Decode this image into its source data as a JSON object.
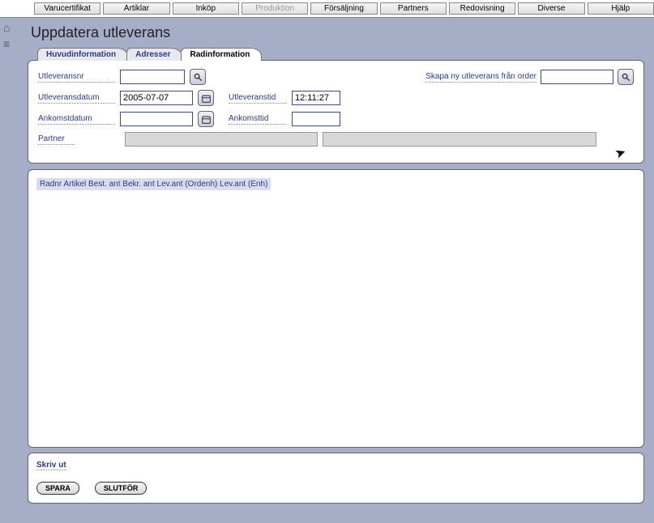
{
  "menu": {
    "items": [
      "Varucertifikat",
      "Artiklar",
      "Inköp",
      "Produktion",
      "Försäljning",
      "Partners",
      "Redovisning",
      "Diverse",
      "Hjälp"
    ],
    "disabled_index": 3
  },
  "page": {
    "title": "Uppdatera utleverans"
  },
  "tabs": [
    "Huvudinformation",
    "Adresser",
    "Radinformation"
  ],
  "form": {
    "utleveransnr_label": "Utleveransnr",
    "utleveransnr_value": "",
    "skapa_label": "Skapa ny utleverans från order",
    "skapa_value": "",
    "utleveransdatum_label": "Utleveransdatum",
    "utleveransdatum_value": "2005-07-07",
    "utleveranstid_label": "Utleveranstid",
    "utleveranstid_value": "12:11:27",
    "ankomstdatum_label": "Ankomstdatum",
    "ankomstdatum_value": "",
    "ankomsttid_label": "Ankomsttid",
    "ankomsttid_value": "",
    "partner_label": "Partner",
    "partner_value1": "",
    "partner_value2": ""
  },
  "grid": {
    "header": "Radnr Artikel Best. ant Bekr. ant Lev.ant (Ordenh) Lev.ant (Enh)"
  },
  "bottom": {
    "print_label": "Skriv ut",
    "save_label": "SPARA",
    "finish_label": "SLUTFÖR"
  }
}
